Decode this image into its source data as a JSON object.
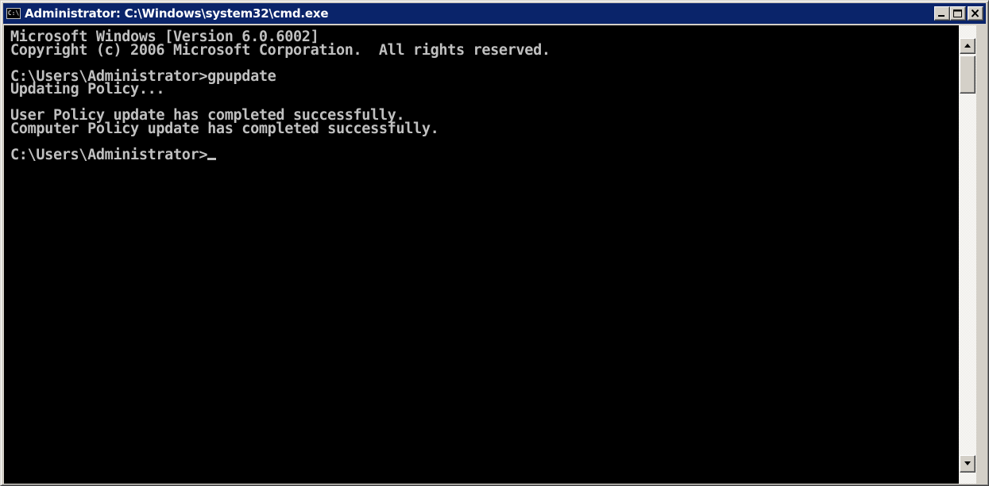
{
  "window": {
    "title": "Administrator: C:\\Windows\\system32\\cmd.exe",
    "icon_label": "C:\\",
    "icon": "cmd-icon"
  },
  "title_buttons": {
    "minimize_icon": "minimize-icon",
    "maximize_icon": "maximize-icon",
    "close_icon": "close-icon"
  },
  "console": {
    "lines": [
      "Microsoft Windows [Version 6.0.6002]",
      "Copyright (c) 2006 Microsoft Corporation.  All rights reserved.",
      "",
      "C:\\Users\\Administrator>gpupdate",
      "Updating Policy...",
      "",
      "User Policy update has completed successfully.",
      "Computer Policy update has completed successfully.",
      "",
      "C:\\Users\\Administrator>"
    ],
    "foreground": "#c0c0c0",
    "background": "#000000"
  },
  "colors": {
    "titlebar": "#0a246a",
    "chrome": "#d4d0c8"
  },
  "scrollbar": {
    "up_icon": "arrow-up-icon",
    "down_icon": "arrow-down-icon"
  }
}
